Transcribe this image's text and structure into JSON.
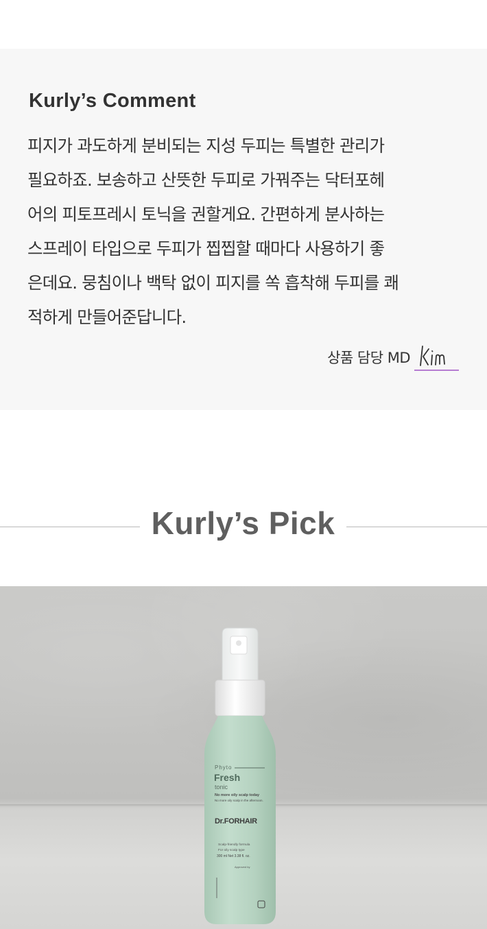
{
  "comment": {
    "title": "Kurly’s Comment",
    "lines": [
      "피지가 과도하게 분비되는 지성 두피는 특별한 관리가",
      "필요하죠. 보송하고 산뜻한 두피로 가꿔주는 닥터포헤",
      "어의 피토프레시 토닉을 권할게요. 간편하게 분사하는",
      "스프레이 타입으로 두피가 찝찝할 때마다 사용하기 좋",
      "은데요. 뭉침이나 백탁 없이 피지를 쏙 흡착해 두피를 쾌",
      "적하게 만들어준답니다."
    ],
    "signature_label": "상품 담당 MD",
    "signature_name": "Kim",
    "signature_color": "#b67cd2"
  },
  "pick": {
    "title": "Kurly’s Pick"
  },
  "product": {
    "label": {
      "phyto": "Phyto",
      "fresh": "Fresh",
      "tonic": "tonic",
      "tagline1": "No more oily scalp today",
      "tagline2": "No more oily scalp in the afternoon.",
      "brand": "Dr.FORHAIR",
      "feature1": "Scalp-friendly formula",
      "feature2": "For oily scalp type",
      "volume": "300 ml Net 3.38 fl. oz.",
      "approved": "Approved by"
    },
    "bottle_color": "#b9d6c4",
    "cap_color": "#f4f4f4"
  }
}
